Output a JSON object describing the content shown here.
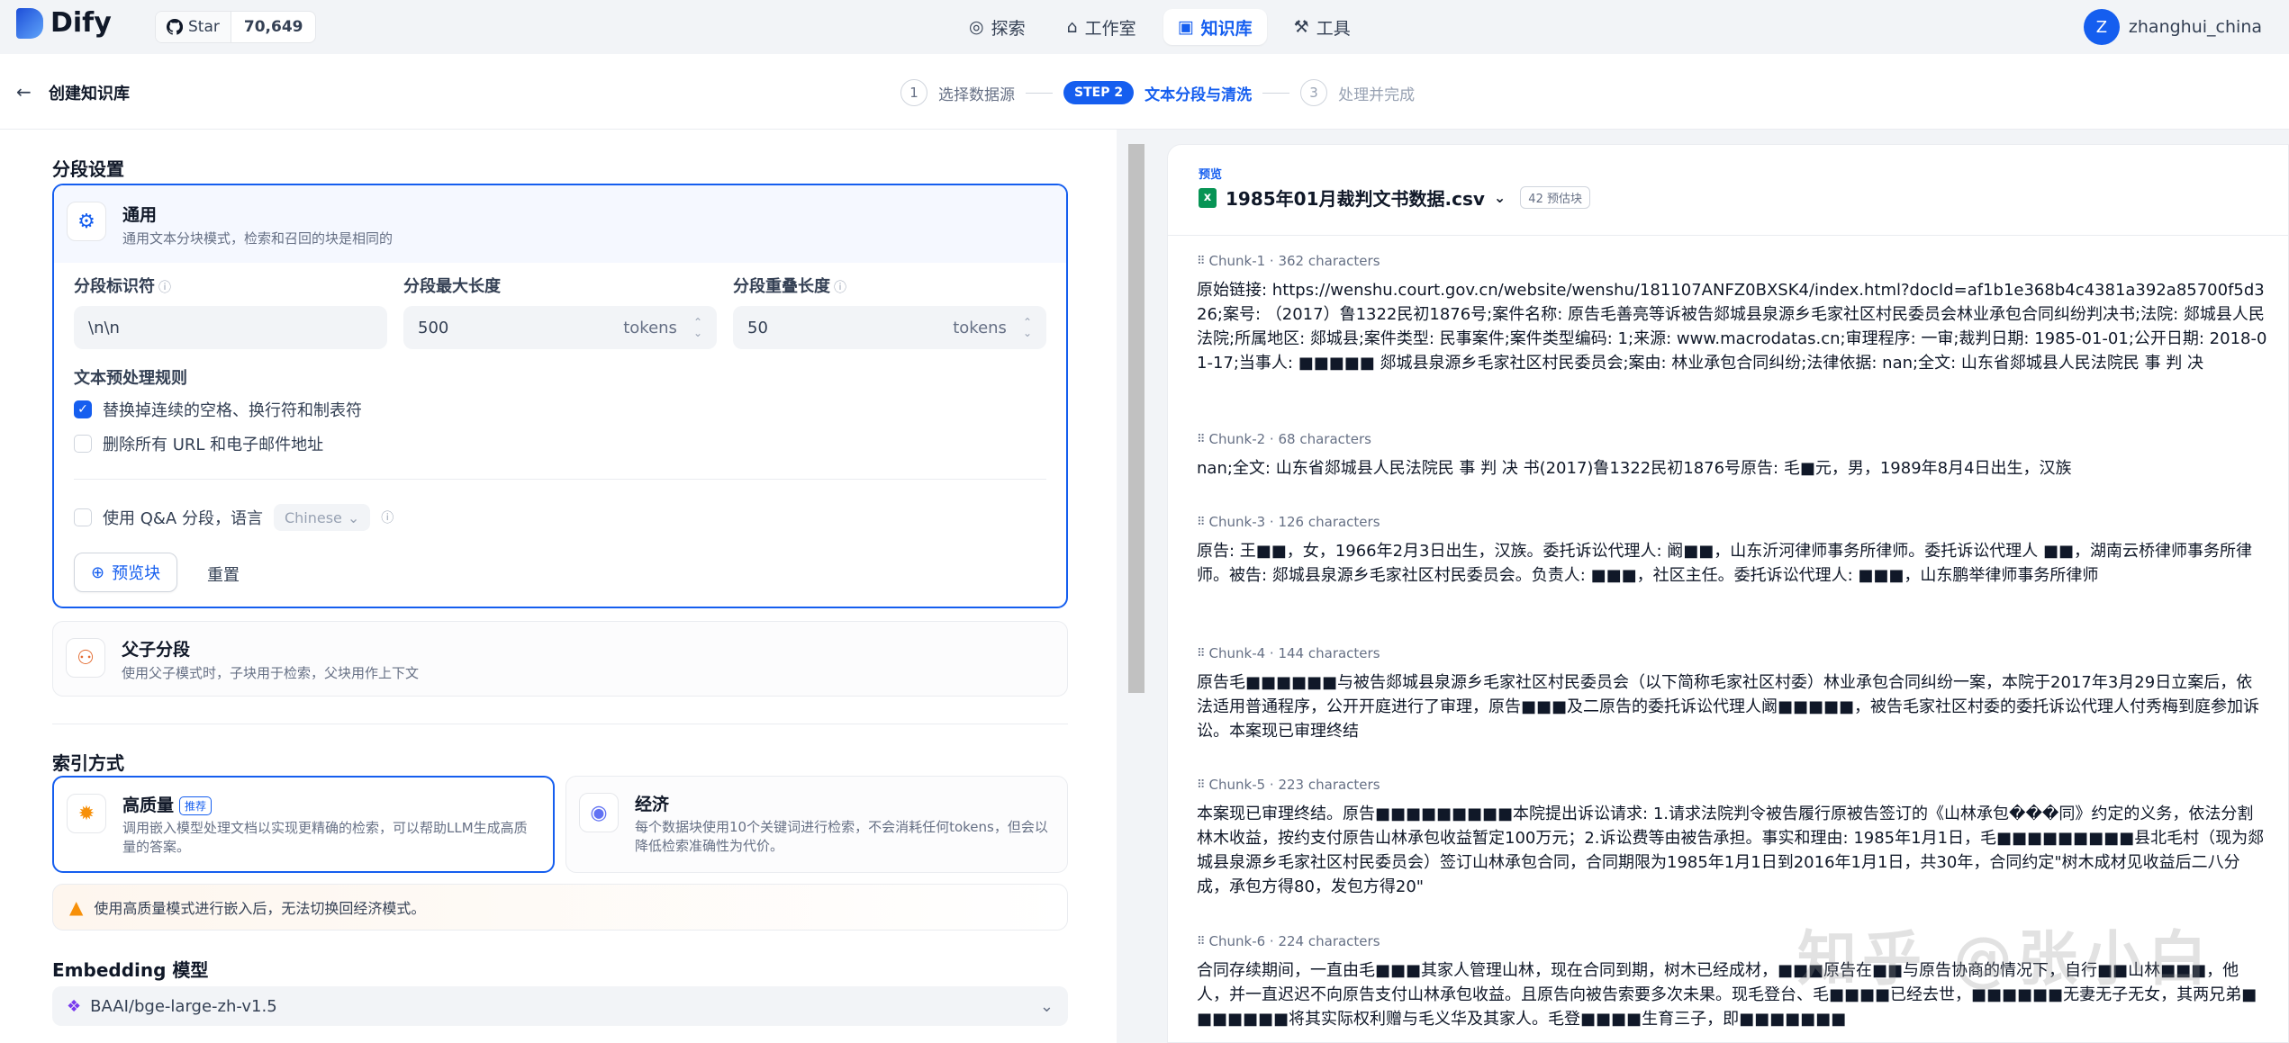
{
  "app": {
    "name": "Dify",
    "github": {
      "star_label": "Star",
      "star_count": "70,649"
    }
  },
  "nav": [
    {
      "label": "探索",
      "icon": "compass-icon"
    },
    {
      "label": "工作室",
      "icon": "robot-icon"
    },
    {
      "label": "知识库",
      "icon": "book-icon",
      "active": true
    },
    {
      "label": "工具",
      "icon": "hammer-icon"
    }
  ],
  "user": {
    "initial": "Z",
    "name": "zhanghui_china"
  },
  "header": {
    "title": "创建知识库",
    "steps": [
      {
        "num": "1",
        "label": "选择数据源"
      },
      {
        "badge": "STEP 2",
        "label": "文本分段与清洗"
      },
      {
        "num": "3",
        "label": "处理并完成"
      }
    ]
  },
  "segment": {
    "section_title": "分段设置",
    "general": {
      "title": "通用",
      "desc": "通用文本分块模式，检索和召回的块是相同的",
      "identifier_label": "分段标识符",
      "identifier_value": "\\n\\n",
      "max_len_label": "分段最大长度",
      "max_len_value": "500",
      "overlap_label": "分段重叠长度",
      "overlap_value": "50",
      "unit": "tokens",
      "rules_title": "文本预处理规则",
      "rule1": "替换掉连续的空格、换行符和制表符",
      "rule1_checked": true,
      "rule2": "删除所有 URL 和电子邮件地址",
      "rule2_checked": false,
      "qa_label": "使用 Q&A 分段，语言",
      "qa_lang": "Chinese",
      "preview_btn": "预览块",
      "reset_btn": "重置"
    },
    "parent_child": {
      "title": "父子分段",
      "desc": "使用父子模式时，子块用于检索，父块用作上下文"
    }
  },
  "index": {
    "section_title": "索引方式",
    "high": {
      "title": "高质量",
      "badge": "推荐",
      "desc": "调用嵌入模型处理文档以实现更精确的检索，可以帮助LLM生成高质量的答案。"
    },
    "eco": {
      "title": "经济",
      "desc": "每个数据块使用10个关键词进行检索，不会消耗任何tokens，但会以降低检索准确性为代价。"
    },
    "warning": "使用高质量模式进行嵌入后，无法切换回经济模式。"
  },
  "embedding": {
    "section_title": "Embedding 模型",
    "model": "BAAI/bge-large-zh-v1.5"
  },
  "preview": {
    "label": "预览",
    "file": "1985年01月裁判文书数据.csv",
    "chunk_count": "42 预估块",
    "chunks": [
      {
        "meta": "Chunk-1 · 362 characters",
        "text": "原始链接: https://wenshu.court.gov.cn/website/wenshu/181107ANFZ0BXSK4/index.html?docId=af1b1e368b4c4381a392a85700f5d326;案号: （2017）鲁1322民初1876号;案件名称: 原告毛善亮等诉被告郯城县泉源乡毛家社区村民委员会林业承包合同纠纷判决书;法院: 郯城县人民法院;所属地区: 郯城县;案件类型: 民事案件;案件类型编码: 1;来源: www.macrodatas.cn;审理程序: 一审;裁判日期: 1985-01-01;公开日期: 2018-01-17;当事人: ■■■■■ 郯城县泉源乡毛家社区村民委员会;案由: 林业承包合同纠纷;法律依据: nan;全文: 山东省郯城县人民法院民 事 判 决"
      },
      {
        "meta": "Chunk-2 · 68 characters",
        "text": "nan;全文: 山东省郯城县人民法院民 事 判 决 书(2017)鲁1322民初1876号原告: 毛■元，男，1989年8月4日出生，汉族"
      },
      {
        "meta": "Chunk-3 · 126 characters",
        "text": "原告: 王■■，女，1966年2月3日出生，汉族。委托诉讼代理人: 阚■■，山东沂河律师事务所律师。委托诉讼代理人 ■■，湖南云桥律师事务所律师。被告: 郯城县泉源乡毛家社区村民委员会。负责人: ■■■，社区主任。委托诉讼代理人: ■■■，山东鹏举律师事务所律师"
      },
      {
        "meta": "Chunk-4 · 144 characters",
        "text": "原告毛■■■■■■与被告郯城县泉源乡毛家社区村民委员会（以下简称毛家社区村委）林业承包合同纠纷一案，本院于2017年3月29日立案后，依法适用普通程序，公开开庭进行了审理，原告■■■及二原告的委托诉讼代理人阚■■■■■，被告毛家社区村委的委托诉讼代理人付秀梅到庭参加诉讼。本案现已审理终结"
      },
      {
        "meta": "Chunk-5 · 223 characters",
        "text": "本案现已审理终结。原告■■■■■■■■■本院提出诉讼请求: 1.请求法院判令被告履行原被告签订的《山林承包���同》约定的义务，依法分割林木收益，按约支付原告山林承包收益暂定100万元；2.诉讼费等由被告承担。事实和理由: 1985年1月1日，毛■■■■■■■■■县北毛村（现为郯城县泉源乡毛家社区村民委员会）签订山林承包合同，合同期限为1985年1月1日到2016年1月1日，共30年，合同约定\"树木成材见收益后二八分成，承包方得80，发包方得20\""
      },
      {
        "meta": "Chunk-6 · 224 characters",
        "text": "合同存续期间，一直由毛■■■其家人管理山林，现在合同到期，树木已经成材，■■■原告在■■与原告协商的情况下，自行■■山林■■■，他人，并一直迟迟不向原告支付山林承包收益。且原告向被告索要多次未果。现毛登台、毛■■■■已经去世，■■■■■■无妻无子无女，其两兄弟■■■■■■■将其实际权利赠与毛义华及其家人。毛登■■■■生育三子，即■■■■■■■"
      }
    ]
  },
  "watermark": "知乎 @张小白"
}
